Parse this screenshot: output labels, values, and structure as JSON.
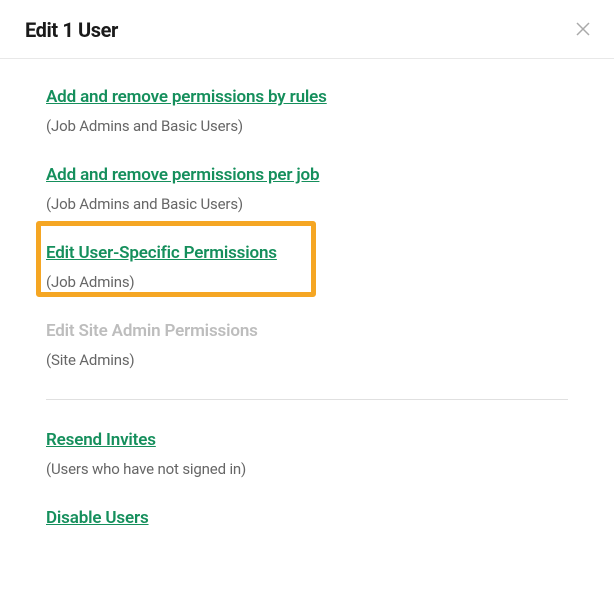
{
  "header": {
    "title": "Edit 1 User"
  },
  "options": {
    "perm_rules": {
      "label": "Add and remove permissions by rules",
      "sub": "(Job Admins and Basic Users)"
    },
    "perm_job": {
      "label": "Add and remove permissions per job",
      "sub": "(Job Admins and Basic Users)"
    },
    "user_specific": {
      "label": "Edit User-Specific Permissions",
      "sub": "(Job Admins)"
    },
    "site_admin": {
      "label": "Edit Site Admin Permissions",
      "sub": "(Site Admins)"
    },
    "resend": {
      "label": "Resend Invites",
      "sub": "(Users who have not signed in)"
    },
    "disable": {
      "label": "Disable Users"
    }
  }
}
